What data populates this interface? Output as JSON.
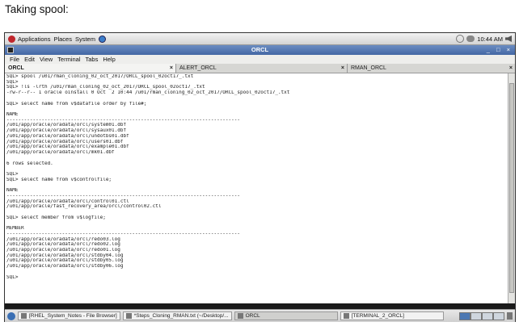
{
  "heading": "Taking spool:",
  "panel": {
    "menus": [
      "Applications",
      "Places",
      "System"
    ],
    "clock": "10:44 AM"
  },
  "window": {
    "title": "ORCL",
    "controls": "_ □ ×",
    "menu": [
      "File",
      "Edit",
      "View",
      "Terminal",
      "Tabs",
      "Help"
    ]
  },
  "tabs": [
    {
      "label": "ORCL",
      "close": "×"
    },
    {
      "label": "ALERT_ORCL",
      "close": "×"
    },
    {
      "label": "RMAN_ORCL",
      "close": "×"
    }
  ],
  "terminal_lines": [
    "SQL> spool /u01/rman_cloning_02_oct_2017/ORCL_spool_02oct17_.txt",
    "SQL>",
    "SQL> !ls -lrth /u01/rman_cloning_02_oct_2017/ORCL_spool_02oct17_.txt",
    "-rw-r--r-- 1 oracle oinstall 0 Oct  2 10:44 /u01/rman_cloning_02_oct_2017/ORCL_spool_02oct17_.txt",
    "",
    "SQL> select name from v$datafile order by file#;",
    "",
    "NAME",
    "--------------------------------------------------------------------------------",
    "/u01/app/oracle/oradata/orcl/system01.dbf",
    "/u01/app/oracle/oradata/orcl/sysaux01.dbf",
    "/u01/app/oracle/oradata/orcl/undotbs01.dbf",
    "/u01/app/oracle/oradata/orcl/users01.dbf",
    "/u01/app/oracle/oradata/orcl/example01.dbf",
    "/u01/app/oracle/oradata/orcl/mk01.dbf",
    "",
    "6 rows selected.",
    "",
    "SQL>",
    "SQL> select name from v$controlfile;",
    "",
    "NAME",
    "--------------------------------------------------------------------------------",
    "/u01/app/oracle/oradata/orcl/control01.ctl",
    "/u01/app/oracle/fast_recovery_area/orcl/control02.ctl",
    "",
    "SQL> select member from v$logfile;",
    "",
    "MEMBER",
    "--------------------------------------------------------------------------------",
    "/u01/app/oracle/oradata/orcl/redo03.log",
    "/u01/app/oracle/oradata/orcl/redo02.log",
    "/u01/app/oracle/oradata/orcl/redo01.log",
    "/u01/app/oracle/oradata/orcl/stdby04.log",
    "/u01/app/oracle/oradata/orcl/stdby05.log",
    "/u01/app/oracle/oradata/orcl/stdby06.log",
    "",
    "SQL> "
  ],
  "taskbar": [
    "[RHEL_System_Notes - File Browser]",
    "*Steps_Cloning_RMAN.txt (~/Desktop/...",
    "ORCL",
    "[TERMINAL_2_ORCL]"
  ]
}
